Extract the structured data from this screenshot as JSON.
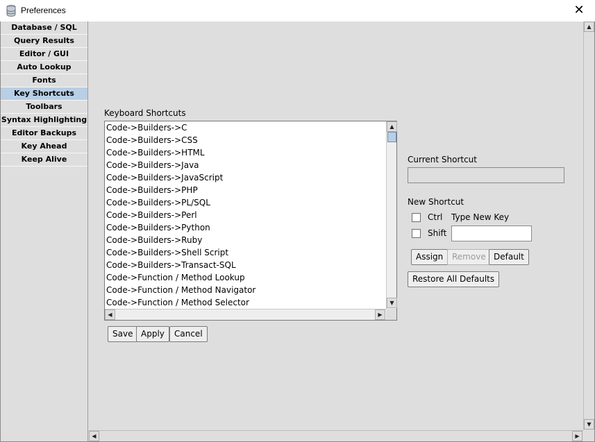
{
  "window": {
    "title": "Preferences",
    "close_glyph": "✕"
  },
  "sidebar": {
    "items": [
      {
        "label": "Database / SQL"
      },
      {
        "label": "Query Results"
      },
      {
        "label": "Editor / GUI"
      },
      {
        "label": "Auto Lookup"
      },
      {
        "label": "Fonts"
      },
      {
        "label": "Key Shortcuts"
      },
      {
        "label": "Toolbars"
      },
      {
        "label": "Syntax Highlighting"
      },
      {
        "label": "Editor Backups"
      },
      {
        "label": "Key Ahead"
      },
      {
        "label": "Keep Alive"
      }
    ],
    "active": "Key Shortcuts"
  },
  "shortcuts": {
    "heading": "Keyboard Shortcuts",
    "items": [
      "Code->Builders->C",
      "Code->Builders->CSS",
      "Code->Builders->HTML",
      "Code->Builders->Java",
      "Code->Builders->JavaScript",
      "Code->Builders->PHP",
      "Code->Builders->PL/SQL",
      "Code->Builders->Perl",
      "Code->Builders->Python",
      "Code->Builders->Ruby",
      "Code->Builders->Shell Script",
      "Code->Builders->Transact-SQL",
      "Code->Function / Method Lookup",
      "Code->Function / Method Navigator",
      "Code->Function / Method Selector"
    ]
  },
  "current_shortcut": {
    "label": "Current Shortcut",
    "value": ""
  },
  "new_shortcut": {
    "label": "New Shortcut",
    "ctrl_label": "Ctrl",
    "shift_label": "Shift",
    "type_key_label": "Type New Key",
    "key_value": "",
    "ctrl_checked": false,
    "shift_checked": false
  },
  "buttons": {
    "assign": "Assign",
    "remove": "Remove",
    "default": "Default",
    "restore_all": "Restore All Defaults",
    "save": "Save",
    "apply": "Apply",
    "cancel": "Cancel"
  },
  "colors": {
    "active_nav": "#b8cfe5",
    "panel_bg": "#dedede"
  }
}
